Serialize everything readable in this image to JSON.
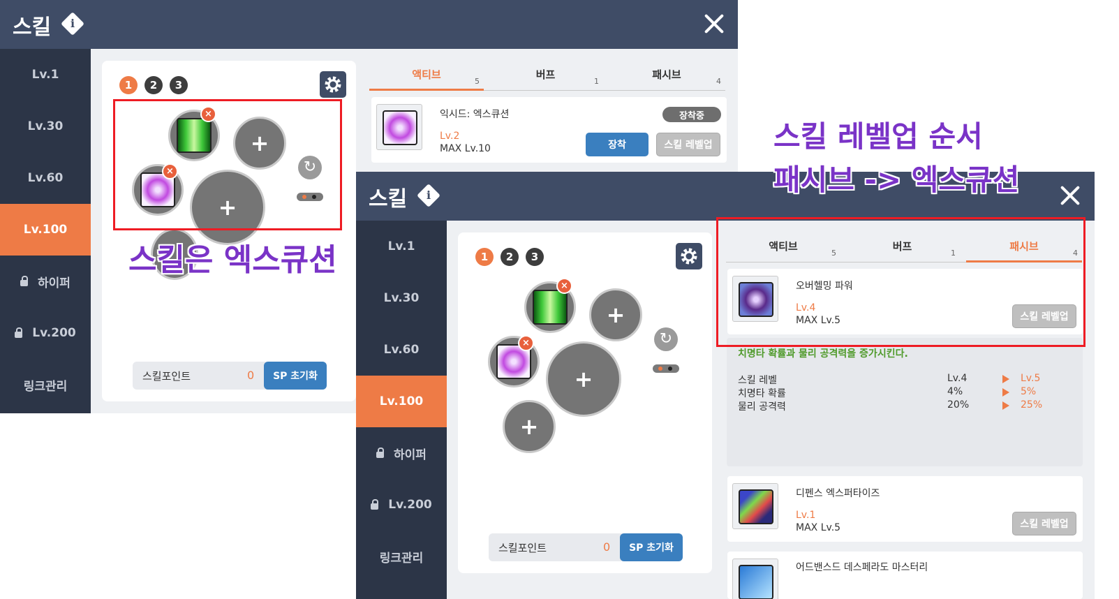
{
  "window": {
    "title": "스킬",
    "sidebar": [
      "Lv.1",
      "Lv.30",
      "Lv.60",
      "Lv.100",
      "하이퍼",
      "Lv.200",
      "링크관리"
    ],
    "preset_numbers": [
      "1",
      "2",
      "3"
    ],
    "sp_label": "스킬포인트",
    "sp_value": "0",
    "sp_reset": "SP 초기화",
    "tabs": [
      {
        "label": "액티브",
        "count": "5"
      },
      {
        "label": "버프",
        "count": "1"
      },
      {
        "label": "패시브",
        "count": "4"
      }
    ]
  },
  "back_window": {
    "active_tab": "액티브",
    "skill": {
      "name": "익시드: 엑스큐션",
      "badge": "장착중",
      "level": "Lv.2",
      "max": "MAX Lv.10",
      "equip_button": "장착",
      "levelup_button": "스킬 레벨업"
    }
  },
  "front_window": {
    "active_tab": "패시브",
    "skills": [
      {
        "name": "오버헬밍 파워",
        "level": "Lv.4",
        "max": "MAX Lv.5",
        "button": "스킬 레벨업"
      },
      {
        "name": "디펜스 엑스퍼타이즈",
        "level": "Lv.1",
        "max": "MAX Lv.5",
        "button": "스킬 레벨업"
      },
      {
        "name": "어드밴스드 데스페라도 마스터리"
      }
    ],
    "detail": {
      "description": "치명타 확률과 물리 공격력을 증가시킨다.",
      "rows": [
        {
          "label": "스킬 레벨",
          "current": "Lv.4",
          "next": "Lv.5"
        },
        {
          "label": "치명타 확률",
          "current": "4%",
          "next": "5%"
        },
        {
          "label": "물리 공격력",
          "current": "20%",
          "next": "25%"
        }
      ]
    }
  },
  "annotations": {
    "left": "스킬은 엑스큐션",
    "right_line1": "스킬 레벨업 순서",
    "right_line2": "패시브 -> 엑스큐션"
  },
  "colors": {
    "accent": "#ee7b46",
    "header": "#3f4c66",
    "sidebar": "#2c3547",
    "annotation": "#7a33c7",
    "highlight_box": "#ee1c24"
  },
  "icons": [
    "info-icon",
    "close-icon",
    "gear-icon",
    "remove-icon",
    "refresh-icon",
    "lock-icon",
    "plus-icon"
  ]
}
